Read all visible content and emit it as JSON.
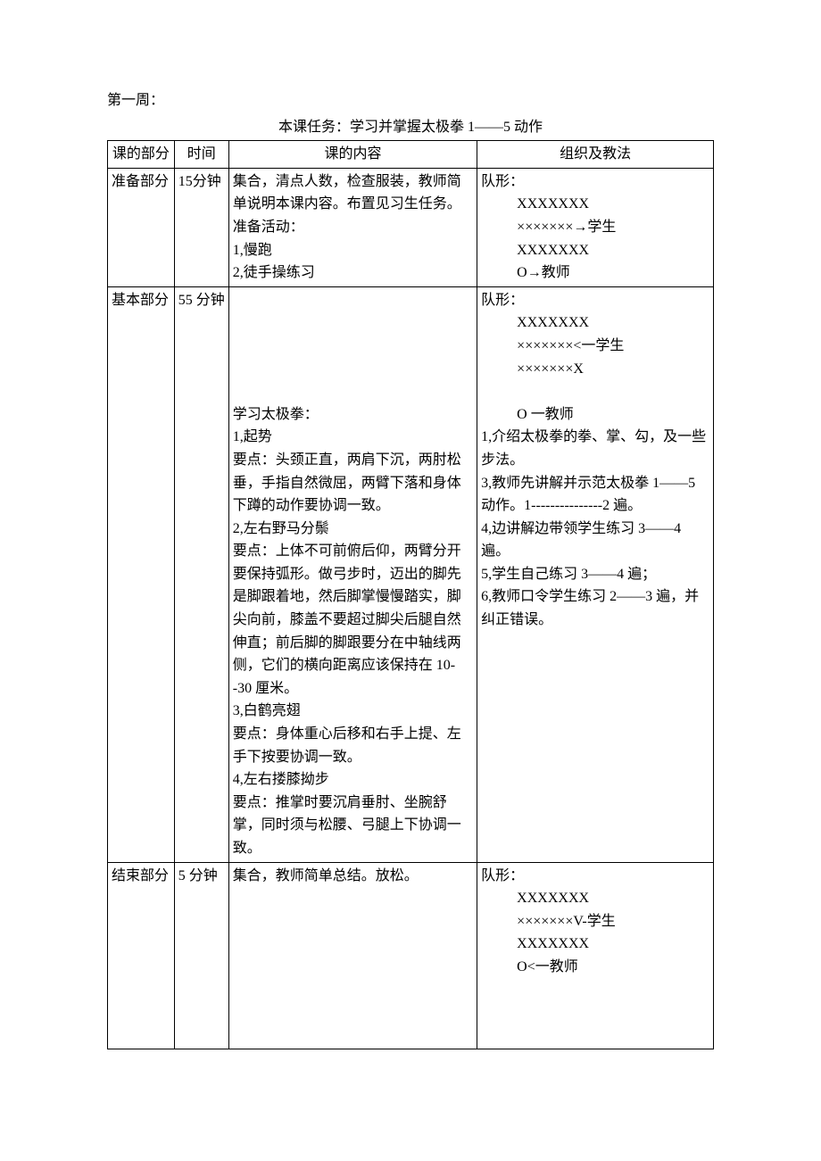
{
  "week": "第一周：",
  "task_prefix": "本课任务：",
  "task_text": "学习并掌握太极拳 1——5 动作",
  "headers": {
    "c1": "课的部分",
    "c2": "时间",
    "c3": "课的内容",
    "c4": "组织及教法"
  },
  "rows": {
    "prep": {
      "part": "准备部分",
      "time": "15分钟",
      "content": "集合，清点人数，检查服装，教师简单说明本课内容。布置见习生任务。\n准备活动：\n1,慢跑\n2,徒手操练习",
      "org_label": "队形：",
      "org_formation": "XXXXXXX\n×××××××→学生\nXXXXXXX\n        O→教师"
    },
    "main": {
      "part": "基本部分",
      "time": "55 分钟",
      "content_pre": "\n\n\n",
      "content": "学习太极拳：\n1,起势\n   要点：头颈正直，两肩下沉，两肘松垂，手指自然微屈，两臂下落和身体下蹲的动作要协调一致。\n2,左右野马分鬃\n要点：上体不可前俯后仰，两臂分开要保持弧形。做弓步时，迈出的脚先是脚跟着地，然后脚掌慢慢踏实，脚尖向前，膝盖不要超过脚尖后腿自然伸直；前后脚的脚跟要分在中轴线两侧，它们的横向距离应该保持在 10--30 厘米。\n3,白鹤亮翅\n要点：身体重心后移和右手上提、左手下按要协调一致。\n4,左右搂膝拗步\n要点：推掌时要沉肩垂肘、坐腕舒掌，同时须与松腰、弓腿上下协调一致。",
      "org_label": "队形：",
      "org_formation": "XXXXXXX\n×××××××<一学生\n×××××××X\n\n       O 一教师",
      "org_notes": "1,介绍太极拳的拳、掌、勾，及一些步法。\n3,教师先讲解并示范太极拳 1——5 动作。1---------------2 遍。\n4,边讲解边带领学生练习 3——4 遍。\n5,学生自己练习 3——4 遍；\n6,教师口令学生练习 2——3 遍，并纠正错误。"
    },
    "end": {
      "part": "结束部分",
      "time": "5 分钟",
      "content": "集合，教师简单总结。放松。",
      "org_label": "队形：",
      "org_formation": "XXXXXXX\n×××××××V-学生\nXXXXXXX\n        O<一教师",
      "trailing": "\n\n\n"
    }
  }
}
